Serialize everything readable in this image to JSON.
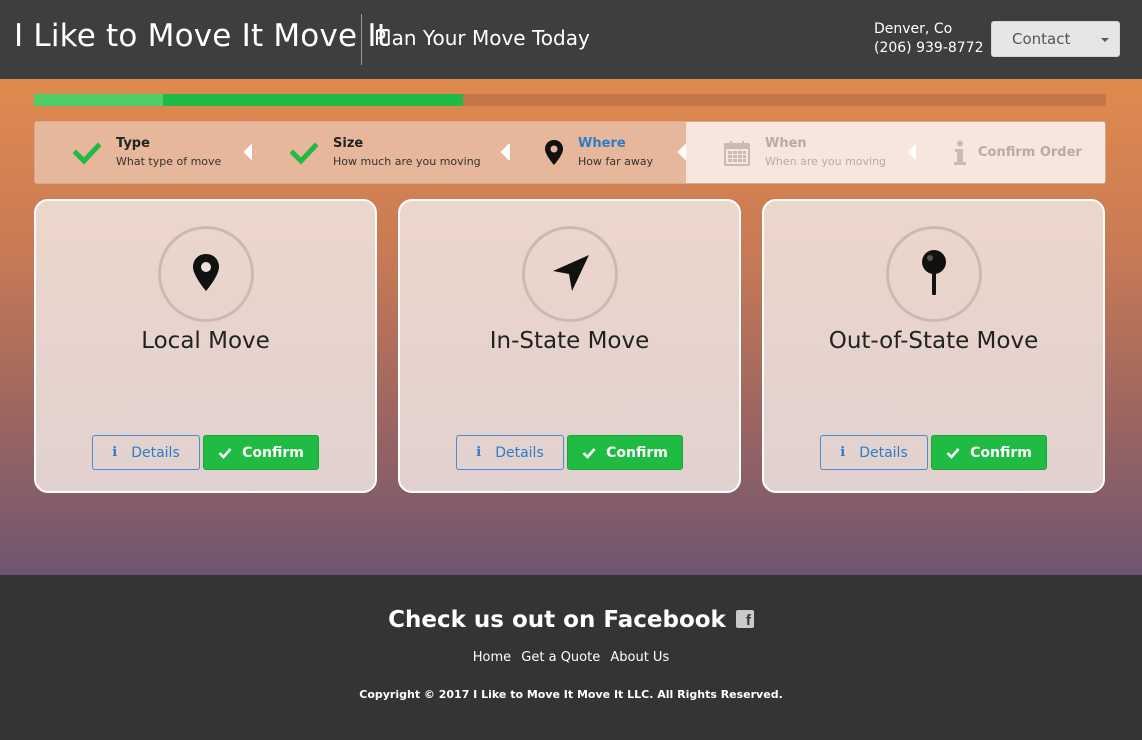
{
  "header": {
    "brand": "I Like to Move It Move It",
    "tagline": "Plan Your Move Today",
    "city": "Denver, Co",
    "phone": "(206) 939-8772",
    "contact_label": "Contact"
  },
  "progress": {
    "percent": 40,
    "completed_highlight_percent": 12
  },
  "steps": [
    {
      "title": "Type",
      "subtitle": "What type of move",
      "state": "done",
      "icon": "check-icon"
    },
    {
      "title": "Size",
      "subtitle": "How much are you moving",
      "state": "done",
      "icon": "check-icon"
    },
    {
      "title": "Where",
      "subtitle": "How far away",
      "state": "active",
      "icon": "map-marker-icon"
    },
    {
      "title": "When",
      "subtitle": "When are you moving",
      "state": "pending",
      "icon": "calendar-icon"
    },
    {
      "title": "Confirm Order",
      "subtitle": "",
      "state": "pending",
      "icon": "info-icon"
    }
  ],
  "cards": [
    {
      "title": "Local Move",
      "icon": "map-marker-icon",
      "details_label": "Details",
      "confirm_label": "Confirm"
    },
    {
      "title": "In-State Move",
      "icon": "location-arrow-icon",
      "details_label": "Details",
      "confirm_label": "Confirm"
    },
    {
      "title": "Out-of-State Move",
      "icon": "push-pin-icon",
      "details_label": "Details",
      "confirm_label": "Confirm"
    }
  ],
  "footer": {
    "facebook_text": "Check us out on Facebook",
    "links": [
      "Home",
      "Get a Quote",
      "About Us"
    ],
    "copyright": "Copyright © 2017 I Like to Move It Move It LLC. All Rights Reserved."
  },
  "colors": {
    "accent_green": "#1fbb43",
    "accent_blue": "#2b7cc9",
    "header_bg": "#3e3e3e",
    "footer_bg": "#343434"
  }
}
